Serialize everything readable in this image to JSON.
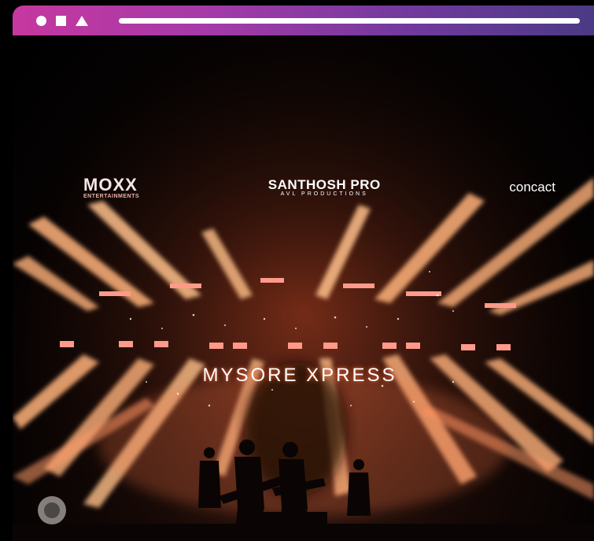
{
  "window": {
    "controls": [
      "circle-icon",
      "square-icon",
      "triangle-icon"
    ],
    "accent_gradient": [
      "#c6389f",
      "#6f3a9d",
      "#4b3a84"
    ]
  },
  "photo": {
    "sponsors": {
      "moxx": "MOXX",
      "moxx_sub": "ENTERTAINMENTS",
      "santhosh": "SANTHOSH PRO",
      "santhosh_sub": "AVL PRODUCTIONS",
      "concact": "concact"
    },
    "stage_title": "MYSORE XPRESS",
    "beam_color": "#ffb27a",
    "backdrop_color": "#000000"
  }
}
